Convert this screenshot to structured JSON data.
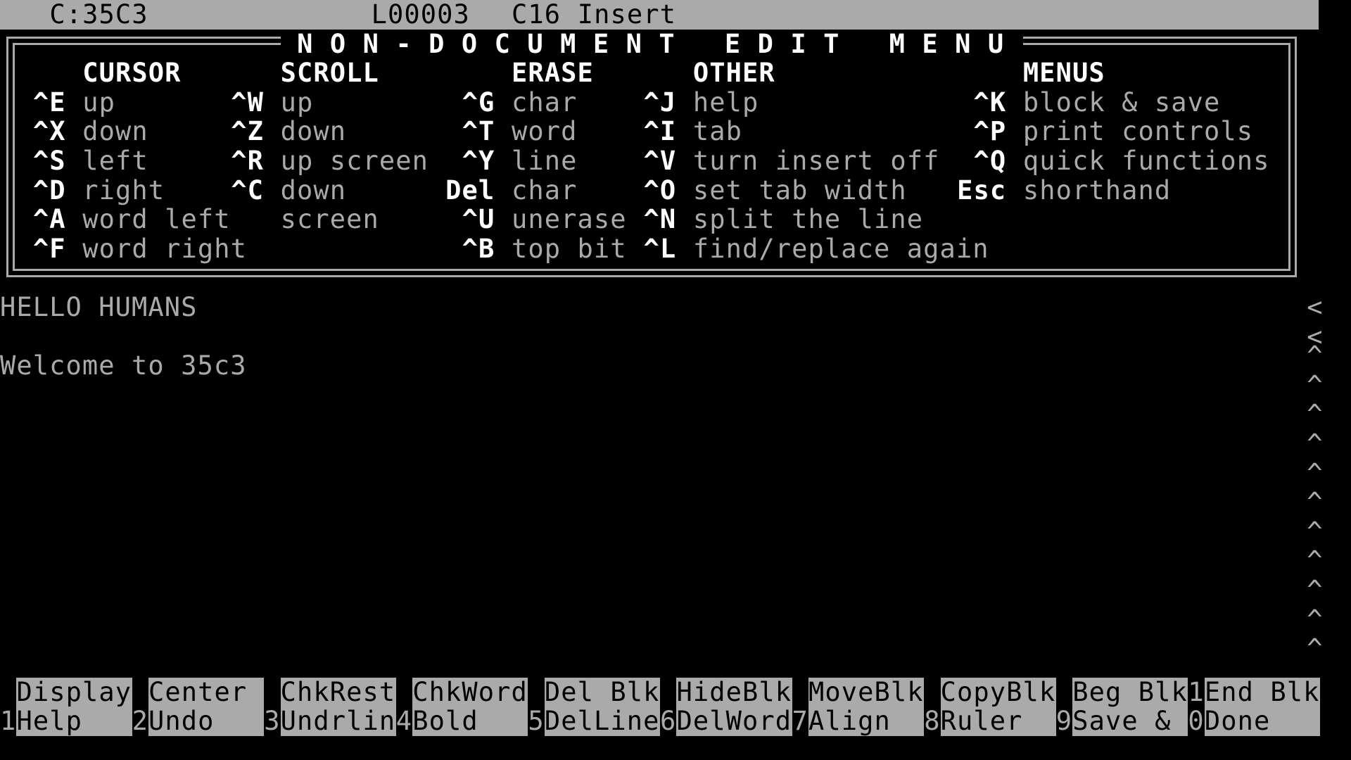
{
  "status": {
    "drive": "C:35C3",
    "line": "L00003",
    "column": "C16",
    "mode": "Insert"
  },
  "menu": {
    "title": "N O N - D O C U M E N T   E D I T   M E N U",
    "headers": {
      "cursor": "CURSOR",
      "scroll": "SCROLL",
      "erase": "ERASE",
      "other": "OTHER",
      "menus": "MENUS"
    },
    "cursor": [
      {
        "key": "^E",
        "label": "up"
      },
      {
        "key": "^X",
        "label": "down"
      },
      {
        "key": "^S",
        "label": "left"
      },
      {
        "key": "^D",
        "label": "right"
      },
      {
        "key": "^A",
        "label": "word left"
      },
      {
        "key": "^F",
        "label": "word right"
      }
    ],
    "scroll": [
      {
        "key": "^W",
        "label": "up"
      },
      {
        "key": "^Z",
        "label": "down"
      },
      {
        "key": "^R",
        "label": "up screen"
      },
      {
        "key": "^C",
        "label": "down"
      },
      {
        "key": "",
        "label": "screen"
      }
    ],
    "erase": [
      {
        "key": "^G",
        "label": "char"
      },
      {
        "key": "^T",
        "label": "word"
      },
      {
        "key": "^Y",
        "label": "line"
      },
      {
        "key": "Del",
        "label": "char"
      },
      {
        "key": "^U",
        "label": "unerase"
      },
      {
        "key": "^B",
        "label": "top bit"
      }
    ],
    "other": [
      {
        "key": "^J",
        "label": "help"
      },
      {
        "key": "^I",
        "label": "tab"
      },
      {
        "key": "^V",
        "label": "turn insert off"
      },
      {
        "key": "^O",
        "label": "set tab width"
      },
      {
        "key": "^N",
        "label": "split the line"
      },
      {
        "key": "^L",
        "label": "find/replace again"
      }
    ],
    "menus": [
      {
        "key": "^K",
        "label": "block & save"
      },
      {
        "key": "^P",
        "label": "print controls"
      },
      {
        "key": "^Q",
        "label": "quick functions"
      },
      {
        "key": "Esc",
        "label": "shorthand"
      }
    ]
  },
  "document": {
    "lines": [
      "HELLO HUMANS",
      "",
      "Welcome to 35c3"
    ]
  },
  "margin_markers": {
    "flow": "<",
    "caret": "^"
  },
  "function_keys": [
    {
      "num": "1",
      "top": "Display",
      "bottom": "Help"
    },
    {
      "num": "2",
      "top": "Center",
      "bottom": "Undo"
    },
    {
      "num": "3",
      "top": "ChkRest",
      "bottom": "Undrlin"
    },
    {
      "num": "4",
      "top": "ChkWord",
      "bottom": "Bold"
    },
    {
      "num": "5",
      "top": "Del Blk",
      "bottom": "DelLine"
    },
    {
      "num": "6",
      "top": "HideBlk",
      "bottom": "DelWord"
    },
    {
      "num": "7",
      "top": "MoveBlk",
      "bottom": "Align"
    },
    {
      "num": "8",
      "top": "CopyBlk",
      "bottom": "Ruler"
    },
    {
      "num": "9",
      "top": "Beg Blk",
      "bottom": "Save &"
    },
    {
      "num": "10",
      "top": "End Blk",
      "bottom": "Done"
    }
  ],
  "colors": {
    "background": "#000000",
    "gray": "#aaaaaa",
    "bright": "#ffffff"
  }
}
